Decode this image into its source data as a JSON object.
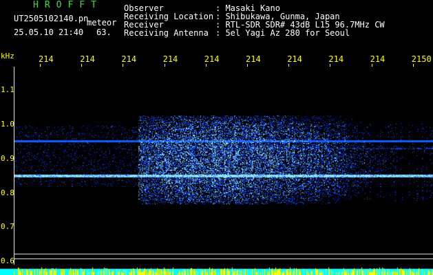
{
  "header": {
    "brand": "HROFFT",
    "file_name": "UT2505102140.pn",
    "meteor_label": "meteor",
    "date_time": "25.05.10 21:40",
    "count": "63.",
    "info": [
      {
        "label": "Observer",
        "value": ": Masaki Kano"
      },
      {
        "label": "Receiving Location",
        "value": ": Shibukawa, Gunma, Japan"
      },
      {
        "label": "Receiver",
        "value": ": RTL-SDR SDR# 43dB L15 96.7MHz CW"
      },
      {
        "label": "Receiving Antenna",
        "value": ": 5el Yagi Az 280 for Seoul"
      }
    ]
  },
  "x_axis": {
    "ticks": [
      "214",
      "214",
      "214",
      "214",
      "214",
      "214",
      "214",
      "214",
      "214",
      "2150"
    ]
  },
  "y_axis": {
    "unit": "kHz",
    "ticks": [
      "1.1",
      "1.0",
      "0.9",
      "0.8",
      "0.7",
      "0.6"
    ]
  },
  "colors": {
    "background": "#000000",
    "header_text": "#ffffff",
    "brand": "#3cdc3c",
    "axis_labels": "#ffff00",
    "signal_low": "#0010a0",
    "signal_mid": "#1060ff",
    "signal_high": "#40e0ff",
    "bar_cyan": "#00ffff",
    "bar_yellow": "#ffff00"
  }
}
